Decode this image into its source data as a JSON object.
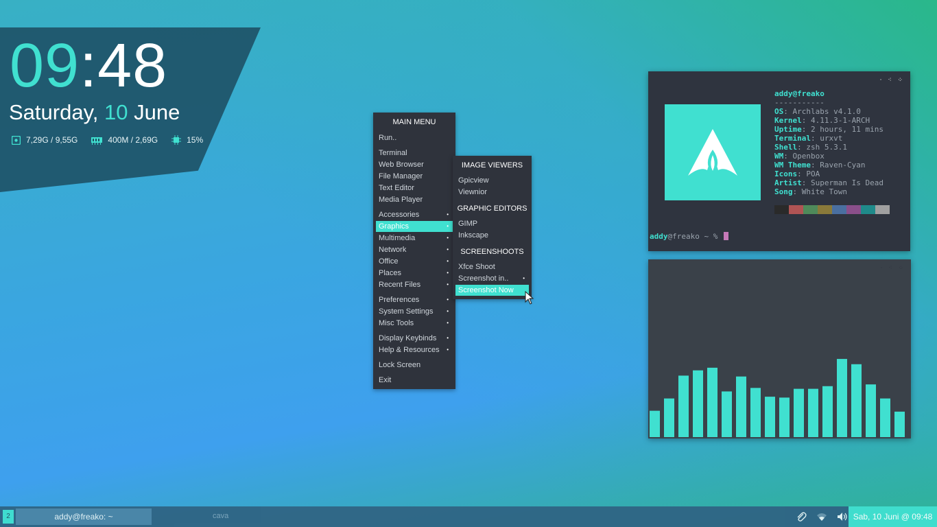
{
  "clock": {
    "hour": "09",
    "sep_min": ":48",
    "weekday": "Saturday, ",
    "day": "10",
    "month": " June"
  },
  "stats": {
    "disk": "7,29G / 9,55G",
    "ram": "400M / 2,69G",
    "cpu": "15%"
  },
  "main_menu": {
    "title": "MAIN MENU",
    "items": [
      "Run..",
      "Terminal",
      "Web Browser",
      "File Manager",
      "Text Editor",
      "Media Player",
      "Accessories",
      "Graphics",
      "Multimedia",
      "Network",
      "Office",
      "Places",
      "Recent Files",
      "Preferences",
      "System Settings",
      "Misc Tools",
      "Display Keybinds",
      "Help & Resources",
      "Lock Screen",
      "Exit"
    ],
    "selected": "Graphics"
  },
  "sub_menu": {
    "headers": [
      "IMAGE VIEWERS",
      "GRAPHIC EDITORS",
      "SCREENSHOOTS"
    ],
    "items": [
      "Gpicview",
      "Viewnior",
      "GIMP",
      "Inkscape",
      "Xfce Shoot",
      "Screenshot in..",
      "Screenshot Now"
    ],
    "selected": "Screenshot Now"
  },
  "neofetch": {
    "userhost": "addy@freako",
    "separator": "-----------",
    "rows": [
      {
        "key": "OS",
        "value": ": Archlabs v4.1.0"
      },
      {
        "key": "Kernel",
        "value": ": 4.11.3-1-ARCH"
      },
      {
        "key": "Uptime",
        "value": ": 2 hours, 11 mins"
      },
      {
        "key": "Terminal",
        "value": ": urxvt"
      },
      {
        "key": "Shell",
        "value": ": zsh 5.3.1"
      },
      {
        "key": "WM",
        "value": ": Openbox"
      },
      {
        "key": "WM Theme",
        "value": ": Raven-Cyan"
      },
      {
        "key": "Icons",
        "value": ": POA"
      },
      {
        "key": "Artist",
        "value": ": Superman Is Dead"
      },
      {
        "key": "Song",
        "value": ": White Town"
      }
    ],
    "palette": [
      "#2a2a2a",
      "#b05454",
      "#4f8a5a",
      "#8a7a3a",
      "#4a6fa0",
      "#8a4f8a",
      "#1f8a8a",
      "#a0a0a0"
    ],
    "prompt_user": "addy",
    "prompt_rest": "@freako ~ %"
  },
  "cava": {
    "levels": [
      0.3,
      0.44,
      0.7,
      0.76,
      0.79,
      0.52,
      0.69,
      0.56,
      0.46,
      0.45,
      0.55,
      0.55,
      0.58,
      0.89,
      0.83,
      0.6,
      0.44,
      0.29
    ]
  },
  "window_controls": "· ⁖ ⁘",
  "taskbar": {
    "workspace": "2",
    "active_task": "addy@freako: ~",
    "task2": "cava",
    "clock": "Sab, 10 Juni @ 09:48"
  },
  "colors": {
    "accent": "#40e0d0",
    "panel": "#2f333c"
  }
}
